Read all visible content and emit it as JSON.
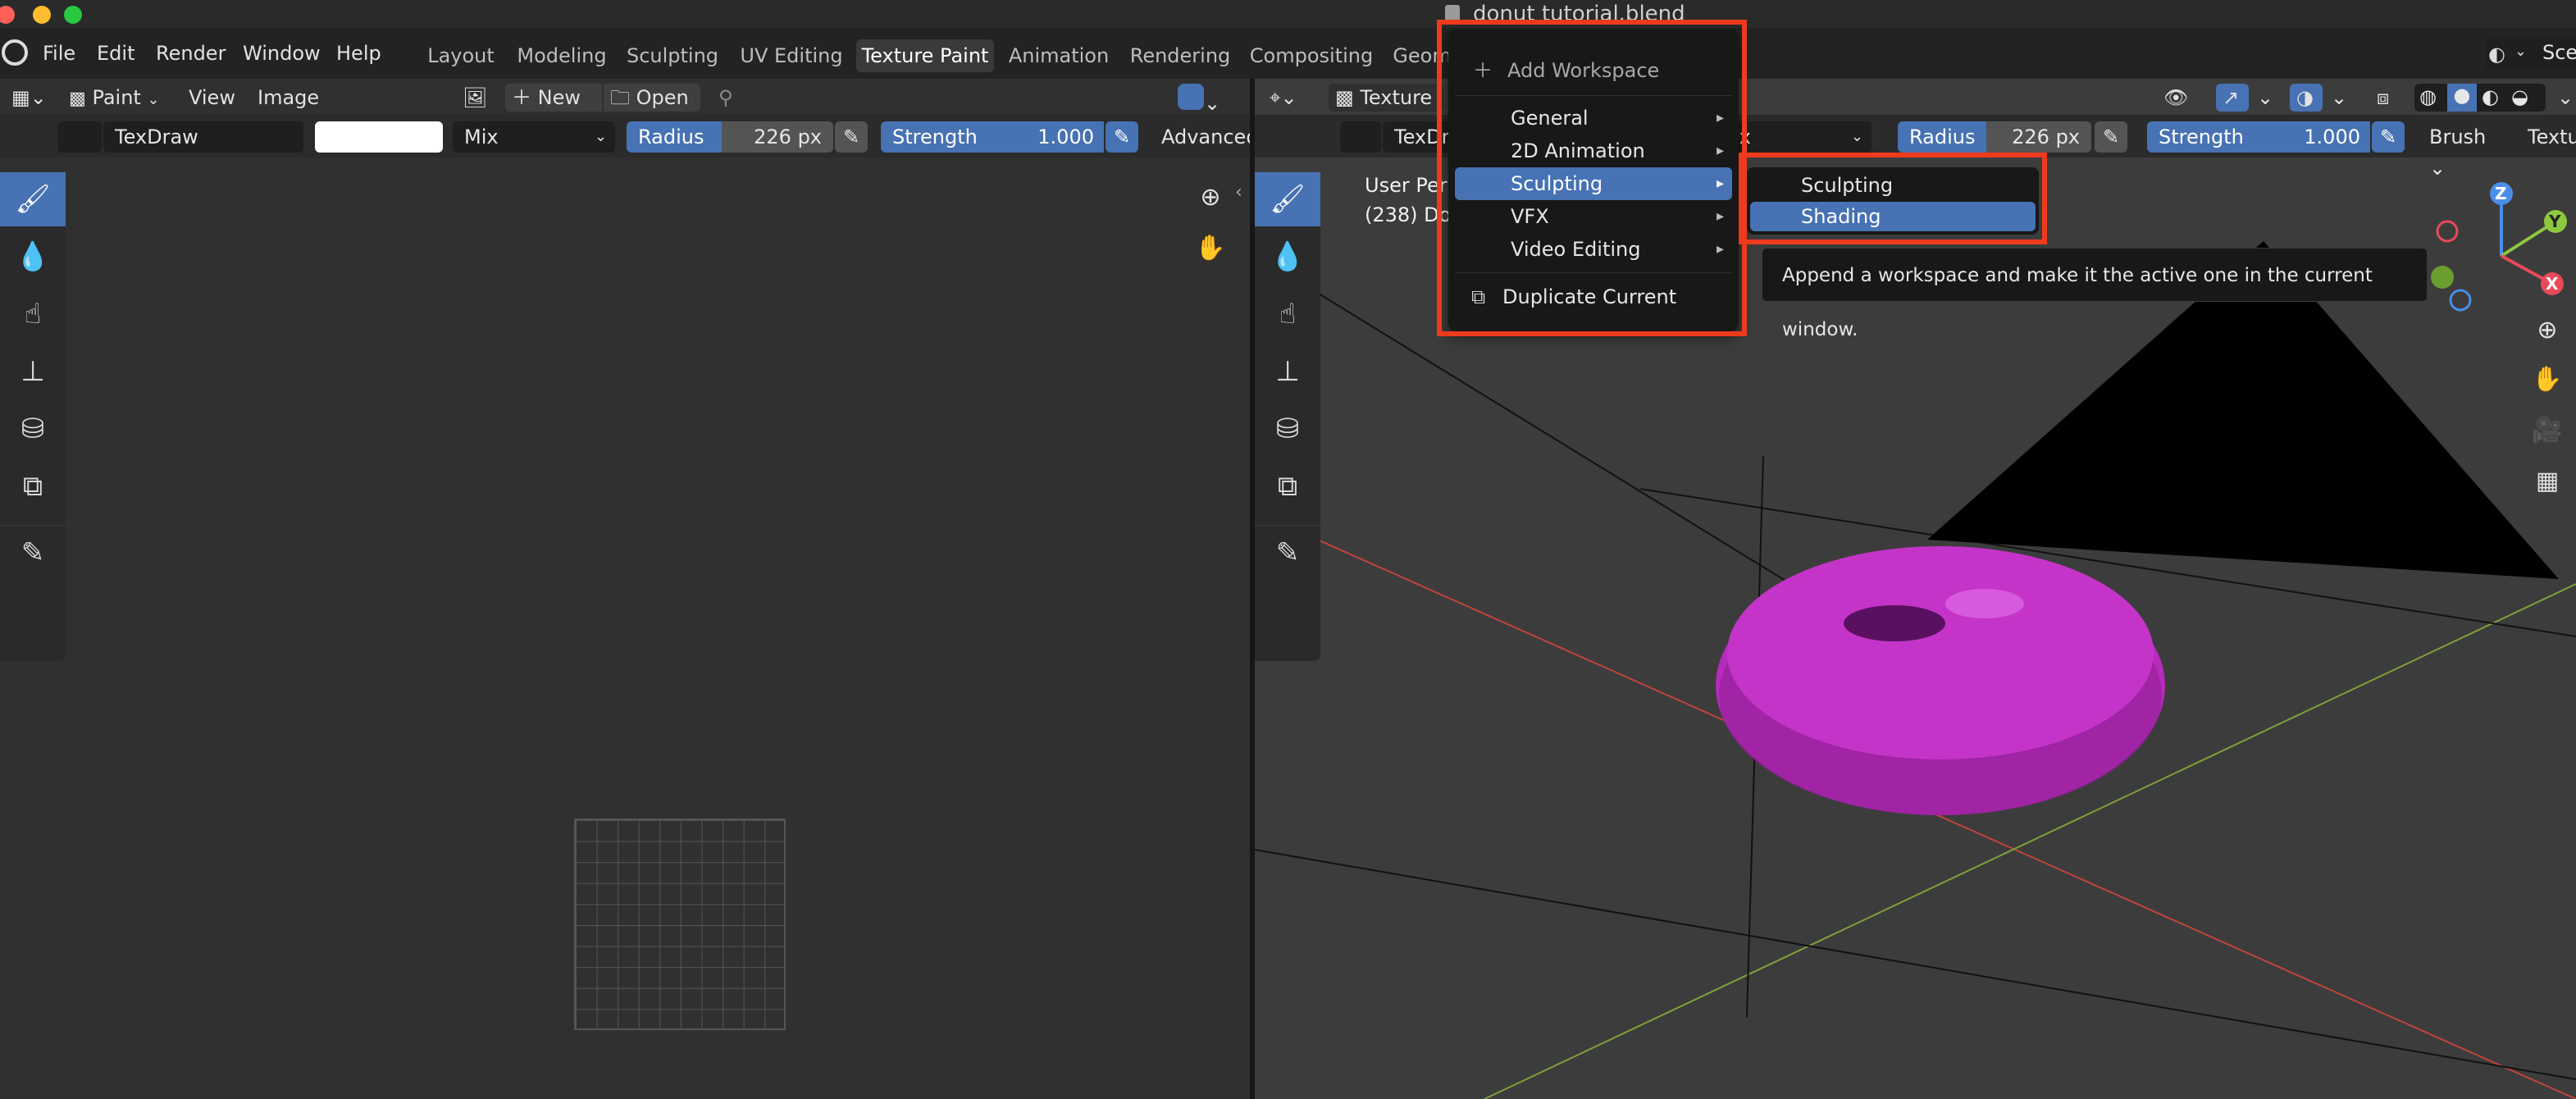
{
  "window": {
    "title": "donut tutorial.blend"
  },
  "menu": [
    "File",
    "Edit",
    "Render",
    "Window",
    "Help"
  ],
  "workspace_tabs": [
    "Layout",
    "Modeling",
    "Sculpting",
    "UV Editing",
    "Texture Paint",
    "Animation",
    "Rendering",
    "Compositing",
    "Geom"
  ],
  "active_tab": "Texture Paint",
  "scene_label": "Sce",
  "left_editor": {
    "mode": "Paint",
    "view_menu": "View",
    "image_menu": "Image",
    "new_label": "New",
    "open_label": "Open",
    "brush_name": "TexDraw",
    "blend_mode": "Mix",
    "radius_label": "Radius",
    "radius_value": "226 px",
    "strength_label": "Strength",
    "strength_value": "1.000",
    "advanced_label": "Advanced"
  },
  "right_editor": {
    "mode": "Texture",
    "brush_name": "TexDra",
    "blend_mode": "ix",
    "radius_label": "Radius",
    "radius_value": "226 px",
    "strength_label": "Strength",
    "strength_value": "1.000",
    "brush_label": "Brush",
    "texture_label": "Textu",
    "overlay_line1": "User Per",
    "overlay_line2": "(238) Do",
    "gizmo": {
      "z": "Z",
      "y": "Y",
      "x": "X"
    }
  },
  "add_workspace_menu": {
    "header": "Add Workspace",
    "items": [
      "General",
      "2D Animation",
      "Sculpting",
      "VFX",
      "Video Editing"
    ],
    "highlighted": "Sculpting",
    "duplicate": "Duplicate Current"
  },
  "submenu": {
    "items": [
      "Sculpting",
      "Shading"
    ],
    "highlighted": "Shading"
  },
  "tooltip": "Append a workspace and make it the active one in the current window.",
  "colors": {
    "accent": "#4772b3",
    "highlight_box": "#ee3a1d",
    "donut": "#b62bbb"
  }
}
